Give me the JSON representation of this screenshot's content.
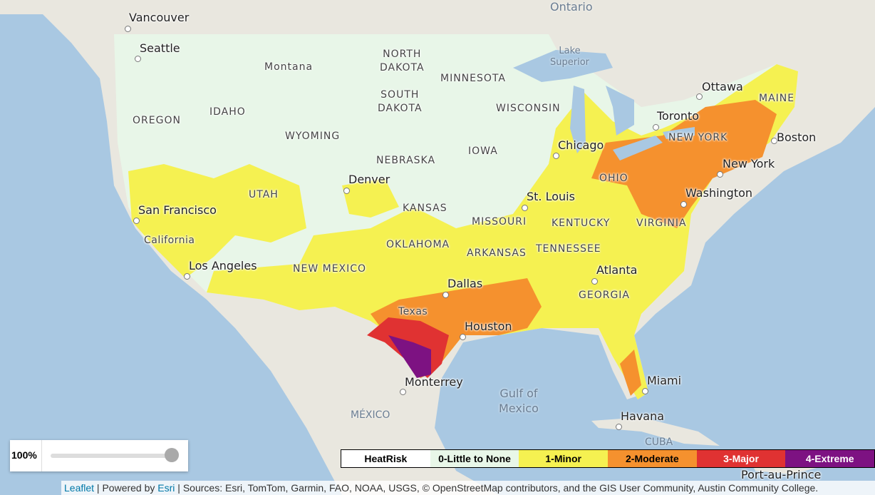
{
  "map": {
    "states": [
      "Montana",
      "NORTH\nDAKOTA",
      "MINNESOTA",
      "SOUTH\nDAKOTA",
      "WISCONSIN",
      "OREGON",
      "IDAHO",
      "WYOMING",
      "NEBRASKA",
      "IOWA",
      "UTAH",
      "KANSAS",
      "MISSOURI",
      "KENTUCKY",
      "VIRGINIA",
      "OKLAHOMA",
      "ARKANSAS",
      "TENNESSEE",
      "NEW MEXICO",
      "GEORGIA",
      "OHIO",
      "NEW YORK",
      "MAINE",
      "California",
      "Texas"
    ],
    "cities": [
      "Vancouver",
      "Seattle",
      "Ottawa",
      "Toronto",
      "Boston",
      "Chicago",
      "New York",
      "Denver",
      "Washington",
      "St. Louis",
      "San Francisco",
      "Los Angeles",
      "Atlanta",
      "Dallas",
      "Houston",
      "Monterrey",
      "Miami",
      "Havana",
      "Port-au-Prince"
    ],
    "geo": [
      "Ontario",
      "Lake\nSuperior",
      "Gulf of\nMexico",
      "MÉXICO",
      "CUBA"
    ]
  },
  "opacity": {
    "value_percent": 100,
    "label": "100%"
  },
  "legend": {
    "title": "HeatRisk",
    "items": [
      {
        "label": "0-Little to None",
        "color": "#e8f7e8",
        "text_color": "#000"
      },
      {
        "label": "1-Minor",
        "color": "#f5f151",
        "text_color": "#000"
      },
      {
        "label": "2-Moderate",
        "color": "#f5912e",
        "text_color": "#000"
      },
      {
        "label": "3-Major",
        "color": "#e03232",
        "text_color": "#fff"
      },
      {
        "label": "4-Extreme",
        "color": "#7d1282",
        "text_color": "#fff"
      }
    ]
  },
  "attribution": {
    "leaflet": "Leaflet",
    "sep1": " | Powered by ",
    "esri": "Esri",
    "sources": " | Sources: Esri, TomTom, Garmin, FAO, NOAA, USGS, © OpenStreetMap contributors, and the GIS User Community, Austin Community College."
  }
}
